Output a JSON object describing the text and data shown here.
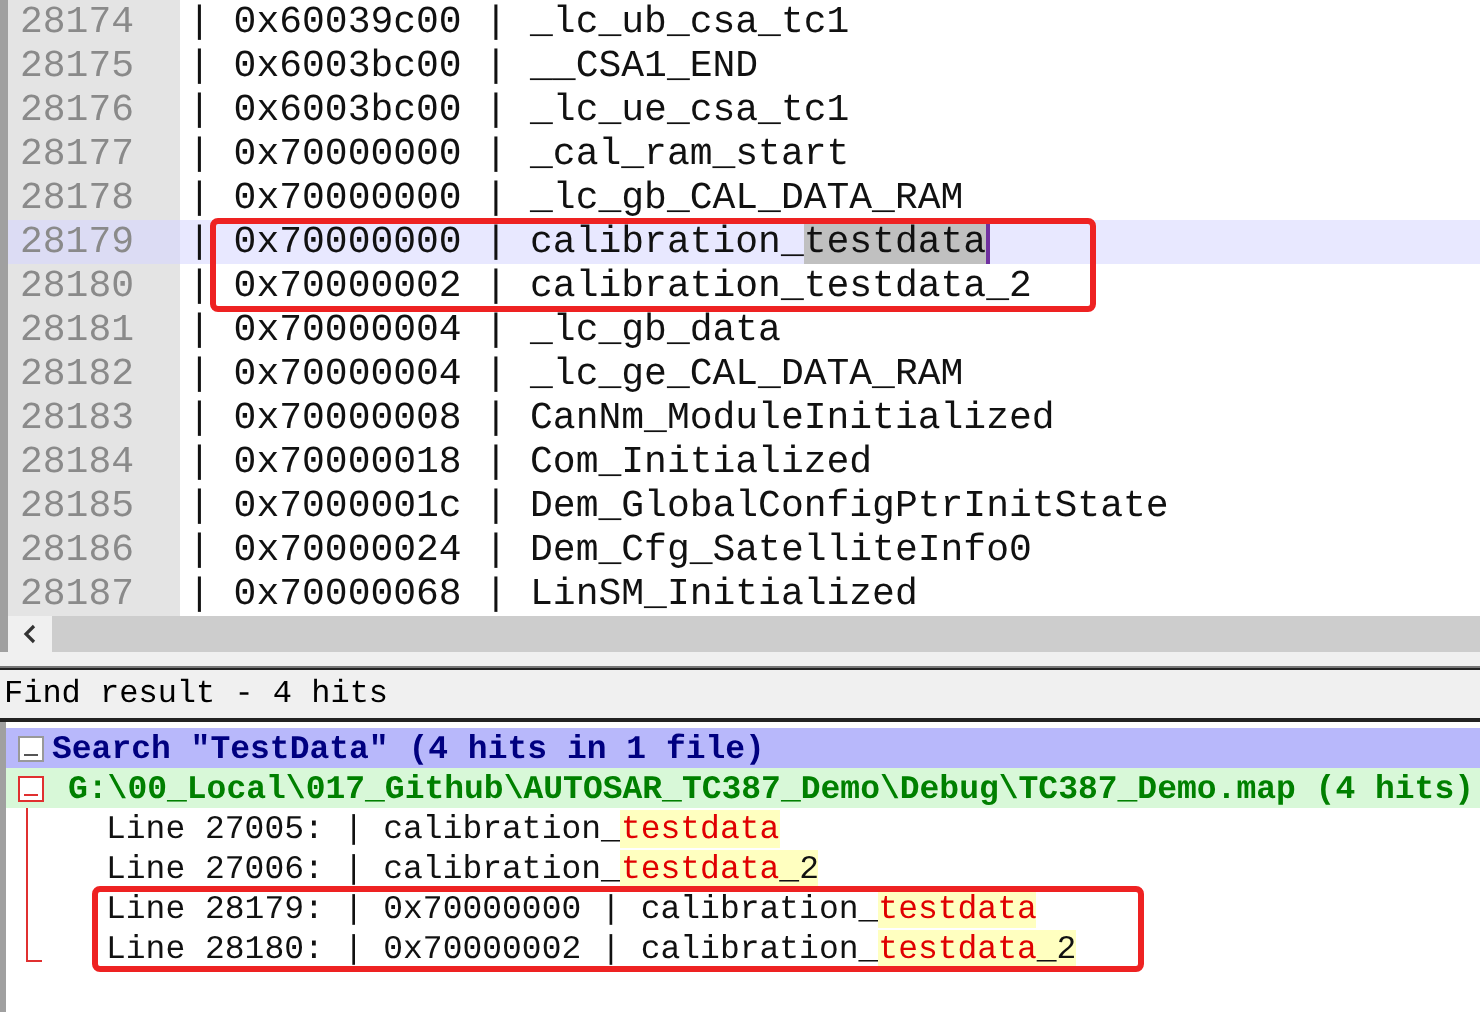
{
  "editor": {
    "lines": [
      {
        "number": "28174",
        "text": "| 0x60039c00 | _lc_ub_csa_tc1",
        "current": false,
        "marked": false
      },
      {
        "number": "28175",
        "text": "| 0x6003bc00 | __CSA1_END",
        "current": false,
        "marked": false
      },
      {
        "number": "28176",
        "text": "| 0x6003bc00 | _lc_ue_csa_tc1",
        "current": false,
        "marked": false
      },
      {
        "number": "28177",
        "text": "| 0x70000000 | _cal_ram_start",
        "current": false,
        "marked": false
      },
      {
        "number": "28178",
        "text": "| 0x70000000 | _lc_gb_CAL_DATA_RAM",
        "current": false,
        "marked": false
      },
      {
        "number": "28179",
        "text": "| 0x70000000 | calibration_",
        "selection": "testdata",
        "current": true,
        "marked": true
      },
      {
        "number": "28180",
        "text": "| 0x70000002 | calibration_testdata_2",
        "current": false,
        "marked": true
      },
      {
        "number": "28181",
        "text": "| 0x70000004 | _lc_gb_data",
        "current": false,
        "marked": false
      },
      {
        "number": "28182",
        "text": "| 0x70000004 | _lc_ge_CAL_DATA_RAM",
        "current": false,
        "marked": false
      },
      {
        "number": "28183",
        "text": "| 0x70000008 | CanNm_ModuleInitialized",
        "current": false,
        "marked": false
      },
      {
        "number": "28184",
        "text": "| 0x70000018 | Com_Initialized",
        "current": false,
        "marked": false
      },
      {
        "number": "28185",
        "text": "| 0x7000001c | Dem_GlobalConfigPtrInitState",
        "current": false,
        "marked": false
      },
      {
        "number": "28186",
        "text": "| 0x70000024 | Dem_Cfg_SatelliteInfo0",
        "current": false,
        "marked": false
      },
      {
        "number": "28187",
        "text": "| 0x70000068 | LinSM_Initialized",
        "current": false,
        "marked": false
      }
    ]
  },
  "find_result": {
    "title": "Find result - 4 hits",
    "search": {
      "label": "Search \"TestData\" (4 hits in 1 file)",
      "expanded": true,
      "files": [
        {
          "label": "G:\\00_Local\\017_Github\\AUTOSAR_TC387_Demo\\Debug\\TC387_Demo.map (4 hits)",
          "expanded": true,
          "hits": [
            {
              "text": "Line 27005: | calibration_",
              "match": "testdata",
              "marked": false
            },
            {
              "text": "Line 27006: | calibration_",
              "match": "testdata",
              "rest": "_2",
              "marked": false
            },
            {
              "text": "Line 28179: | 0x70000000 | calibration_",
              "match": "testdata",
              "marked": true
            },
            {
              "text": "Line 28180: | 0x70000002 | calibration_",
              "match": "testdata",
              "rest": "_2",
              "marked": true
            }
          ]
        }
      ]
    }
  }
}
